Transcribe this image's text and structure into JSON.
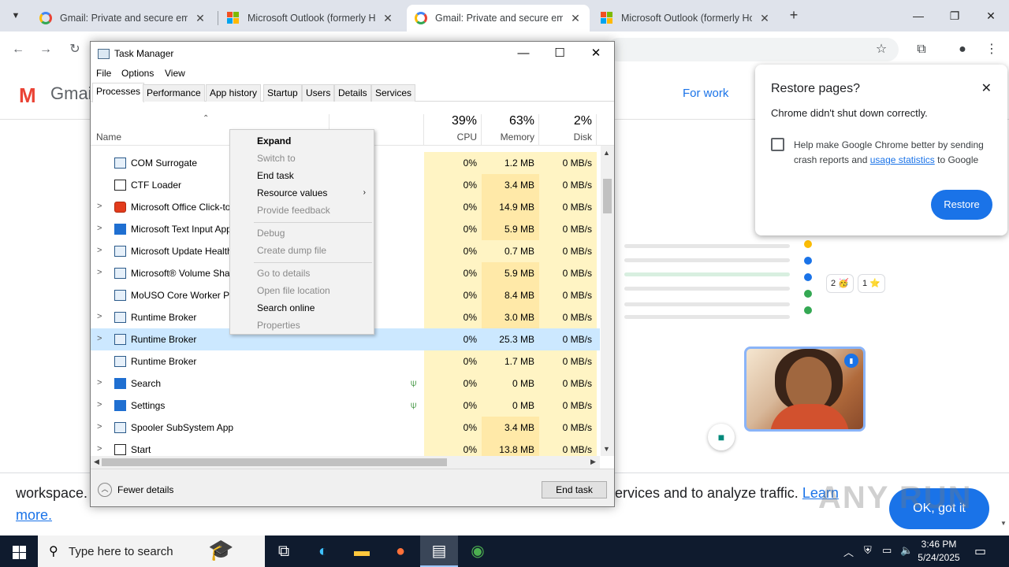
{
  "browser": {
    "tabs": [
      {
        "label": "Gmail: Private and secure email",
        "icon": "google-g-icon",
        "active": false
      },
      {
        "label": "Microsoft Outlook (formerly Hotmail)",
        "icon": "microsoft-logo-icon",
        "active": false
      },
      {
        "label": "Gmail: Private and secure email",
        "icon": "google-g-icon",
        "active": true
      },
      {
        "label": "Microsoft Outlook (formerly Hotmail)",
        "icon": "microsoft-logo-icon",
        "active": false
      }
    ],
    "new_tab": "+",
    "close": "✕"
  },
  "gmail": {
    "logo_word": "Gmail",
    "for_work": "For work",
    "cookie_left_1": "workspace.",
    "cookie_left_2": "more.",
    "cookie_right": "ervices and to analyze traffic.",
    "cookie_link": "Learn",
    "ok_button": "OK, got it",
    "reactions": [
      "2 🥳",
      "1 ⭐"
    ]
  },
  "restore_popup": {
    "title": "Restore pages?",
    "message": "Chrome didn't shut down correctly.",
    "help_text_1": "Help make Google Chrome better by sending crash reports and",
    "help_link": "usage statistics",
    "help_text_2": "to Google",
    "restore_button": "Restore",
    "close": "✕"
  },
  "task_manager": {
    "title": "Task Manager",
    "menu": [
      "File",
      "Options",
      "View"
    ],
    "tabs": [
      "Processes",
      "Performance",
      "App history",
      "Startup",
      "Users",
      "Details",
      "Services"
    ],
    "active_tab": "Processes",
    "columns": {
      "name": "Name",
      "cpu": {
        "pct": "39%",
        "label": "CPU"
      },
      "memory": {
        "pct": "63%",
        "label": "Memory"
      },
      "disk": {
        "pct": "2%",
        "label": "Disk"
      }
    },
    "rows": [
      {
        "name": "COM Surrogate",
        "expand": "",
        "cpu": "0%",
        "mem": "1.2 MB",
        "disk": "0 MB/s"
      },
      {
        "name": "CTF Loader",
        "expand": "",
        "cpu": "0%",
        "mem": "3.4 MB",
        "disk": "0 MB/s"
      },
      {
        "name": "Microsoft Office Click-to-Run",
        "expand": ">",
        "cpu": "0%",
        "mem": "14.9 MB",
        "disk": "0 MB/s"
      },
      {
        "name": "Microsoft Text Input Application",
        "expand": ">",
        "cpu": "0%",
        "mem": "5.9 MB",
        "disk": "0 MB/s"
      },
      {
        "name": "Microsoft Update Health Service",
        "expand": ">",
        "cpu": "0%",
        "mem": "0.7 MB",
        "disk": "0 MB/s"
      },
      {
        "name": "Microsoft® Volume Shadow Copy",
        "expand": ">",
        "cpu": "0%",
        "mem": "5.9 MB",
        "disk": "0 MB/s"
      },
      {
        "name": "MoUSO Core Worker Process",
        "expand": "",
        "cpu": "0%",
        "mem": "8.4 MB",
        "disk": "0 MB/s"
      },
      {
        "name": "Runtime Broker",
        "expand": ">",
        "cpu": "0%",
        "mem": "3.0 MB",
        "disk": "0 MB/s"
      },
      {
        "name": "Runtime Broker",
        "expand": ">",
        "cpu": "0%",
        "mem": "25.3 MB",
        "disk": "0 MB/s",
        "selected": true
      },
      {
        "name": "Runtime Broker",
        "expand": "",
        "cpu": "0%",
        "mem": "1.7 MB",
        "disk": "0 MB/s"
      },
      {
        "name": "Search",
        "expand": ">",
        "cpu": "0%",
        "mem": "0 MB",
        "disk": "0 MB/s",
        "suspended": true
      },
      {
        "name": "Settings",
        "expand": ">",
        "cpu": "0%",
        "mem": "0 MB",
        "disk": "0 MB/s",
        "suspended": true
      },
      {
        "name": "Spooler SubSystem App",
        "expand": ">",
        "cpu": "0%",
        "mem": "3.4 MB",
        "disk": "0 MB/s"
      },
      {
        "name": "Start",
        "expand": ">",
        "cpu": "0%",
        "mem": "13.8 MB",
        "disk": "0 MB/s"
      }
    ],
    "fewer_details": "Fewer details",
    "end_task": "End task"
  },
  "context_menu": {
    "items": [
      {
        "label": "Expand",
        "enabled": true,
        "bold": true
      },
      {
        "label": "Switch to",
        "enabled": false
      },
      {
        "label": "End task",
        "enabled": true
      },
      {
        "label": "Resource values",
        "enabled": true,
        "submenu": true
      },
      {
        "label": "Provide feedback",
        "enabled": false
      },
      {
        "label": "Debug",
        "enabled": false
      },
      {
        "label": "Create dump file",
        "enabled": false
      },
      {
        "label": "Go to details",
        "enabled": false
      },
      {
        "label": "Open file location",
        "enabled": false
      },
      {
        "label": "Search online",
        "enabled": true
      },
      {
        "label": "Properties",
        "enabled": false
      }
    ]
  },
  "taskbar": {
    "search_placeholder": "Type here to search",
    "time": "3:46 PM",
    "date": "5/24/2025"
  },
  "watermark": "ANY RUN"
}
